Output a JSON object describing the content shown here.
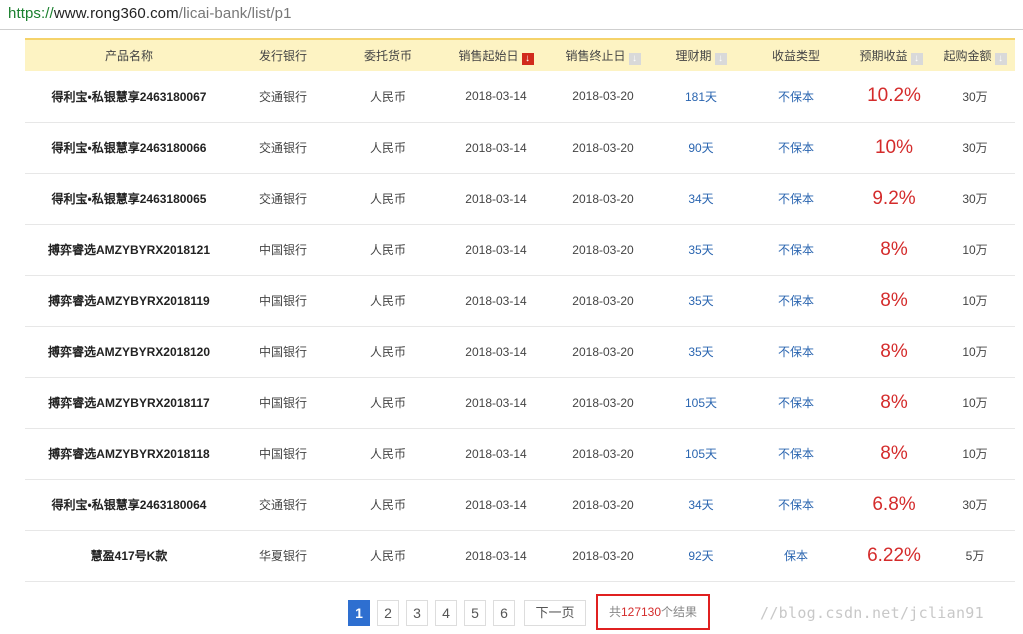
{
  "browser": {
    "url_scheme": "https://",
    "url_host": "www.rong360.com",
    "url_path": "/licai-bank/list/p1"
  },
  "table": {
    "headers": [
      "产品名称",
      "发行银行",
      "委托货币",
      "销售起始日",
      "销售终止日",
      "理财期",
      "收益类型",
      "预期收益",
      "起购金额"
    ],
    "sort_icons": {
      "active": "sort-desc-icon",
      "inactive": "sort-desc-icon"
    },
    "rows": [
      {
        "name": "得利宝•私银慧享2463180067",
        "bank": "交通银行",
        "currency": "人民币",
        "start": "2018-03-14",
        "end": "2018-03-20",
        "term": "181天",
        "type": "不保本",
        "yield": "10.2%",
        "min": "30万"
      },
      {
        "name": "得利宝•私银慧享2463180066",
        "bank": "交通银行",
        "currency": "人民币",
        "start": "2018-03-14",
        "end": "2018-03-20",
        "term": "90天",
        "type": "不保本",
        "yield": "10%",
        "min": "30万"
      },
      {
        "name": "得利宝•私银慧享2463180065",
        "bank": "交通银行",
        "currency": "人民币",
        "start": "2018-03-14",
        "end": "2018-03-20",
        "term": "34天",
        "type": "不保本",
        "yield": "9.2%",
        "min": "30万"
      },
      {
        "name": "搏弈睿选AMZYBYRX2018121",
        "bank": "中国银行",
        "currency": "人民币",
        "start": "2018-03-14",
        "end": "2018-03-20",
        "term": "35天",
        "type": "不保本",
        "yield": "8%",
        "min": "10万"
      },
      {
        "name": "搏弈睿选AMZYBYRX2018119",
        "bank": "中国银行",
        "currency": "人民币",
        "start": "2018-03-14",
        "end": "2018-03-20",
        "term": "35天",
        "type": "不保本",
        "yield": "8%",
        "min": "10万"
      },
      {
        "name": "搏弈睿选AMZYBYRX2018120",
        "bank": "中国银行",
        "currency": "人民币",
        "start": "2018-03-14",
        "end": "2018-03-20",
        "term": "35天",
        "type": "不保本",
        "yield": "8%",
        "min": "10万"
      },
      {
        "name": "搏弈睿选AMZYBYRX2018117",
        "bank": "中国银行",
        "currency": "人民币",
        "start": "2018-03-14",
        "end": "2018-03-20",
        "term": "105天",
        "type": "不保本",
        "yield": "8%",
        "min": "10万"
      },
      {
        "name": "搏弈睿选AMZYBYRX2018118",
        "bank": "中国银行",
        "currency": "人民币",
        "start": "2018-03-14",
        "end": "2018-03-20",
        "term": "105天",
        "type": "不保本",
        "yield": "8%",
        "min": "10万"
      },
      {
        "name": "得利宝•私银慧享2463180064",
        "bank": "交通银行",
        "currency": "人民币",
        "start": "2018-03-14",
        "end": "2018-03-20",
        "term": "34天",
        "type": "不保本",
        "yield": "6.8%",
        "min": "30万"
      },
      {
        "name": "慧盈417号K款",
        "bank": "华夏银行",
        "currency": "人民币",
        "start": "2018-03-14",
        "end": "2018-03-20",
        "term": "92天",
        "type": "保本",
        "yield": "6.22%",
        "min": "5万"
      }
    ]
  },
  "pagination": {
    "pages": [
      "1",
      "2",
      "3",
      "4",
      "5",
      "6"
    ],
    "current": "1",
    "next_label": "下一页",
    "total_prefix": "共",
    "total_count": "127130",
    "total_suffix": "个结果"
  },
  "watermark": "//blog.csdn.net/jclian91",
  "colors": {
    "header_bg": "#fdf3c3",
    "header_border": "#f5d36a",
    "yield_red": "#d42b2b",
    "link_blue": "#2a65b0",
    "current_page": "#2e6fd0",
    "highlight_box": "#e02020"
  }
}
